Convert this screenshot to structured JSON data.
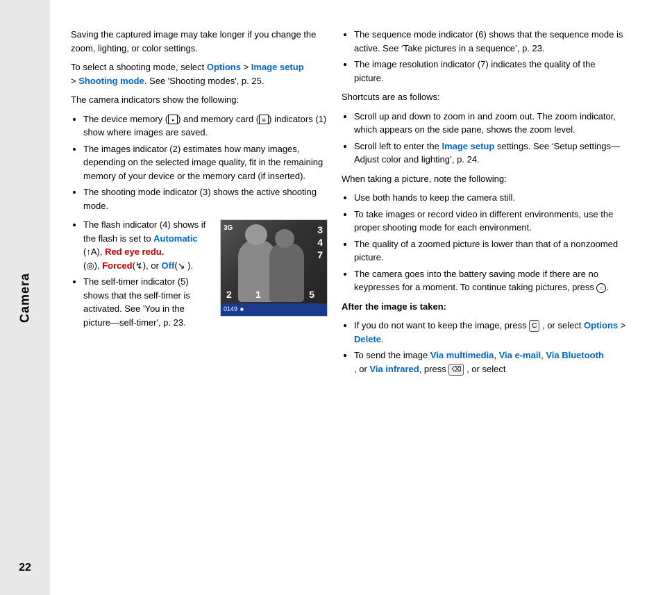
{
  "sidebar": {
    "title": "Camera",
    "page_number": "22"
  },
  "content": {
    "left_column": {
      "intro_text": "Saving the captured image may take longer if you change the zoom, lighting, or color settings.",
      "select_mode_text": "To select a shooting mode, select ",
      "options_link": "Options",
      "greater_than": " > ",
      "image_setup_link": "Image setup",
      "shooting_mode_link": "Shooting mode",
      "see_shooting_modes": ". See 'Shooting modes', p. 25.",
      "indicators_heading": "The camera indicators show the following:",
      "bullet_1": "The device memory (",
      "bullet_1_mid": ") and memory card (",
      "bullet_1_end": ") indicators (1) show where images are saved.",
      "bullet_2": "The images indicator (2) estimates how many images, depending on the selected image quality, fit in the remaining memory of your device or the memory card (if inserted).",
      "bullet_3": "The shooting mode indicator (3) shows the active shooting mode.",
      "bullet_4_start": "The flash indicator (4) shows if the flash is set to ",
      "automatic_link": "Automatic",
      "bullet_4_a_label": "(↑A",
      "bullet_4_a_end": "), ",
      "red_eye_link": "Red eye redu.",
      "bullet_4_b": "(◎), ",
      "forced_link": "Forced",
      "bullet_4_c": "(↯), or ",
      "off_link": "Off",
      "bullet_4_d": "(↘ ).",
      "bullet_5_start": "The self-timer indicator (5) shows that the self-timer is activated. See 'You in the picture—self-timer', p. 23.",
      "camera_numbers": {
        "n3": "3",
        "n4": "4",
        "n7": "7",
        "n2": "2",
        "n1": "1",
        "n5": "5"
      },
      "camera_bottom": {
        "counter": "0149",
        "icon": "■"
      }
    },
    "right_column": {
      "bullet_seq": "The sequence mode indicator (6) shows that the sequence mode is active. See ‘Take pictures in a sequence’, p. 23.",
      "bullet_res": "The image resolution indicator (7) indicates the quality of the picture.",
      "shortcuts_heading": "Shortcuts are as follows:",
      "scroll_zoom": "Scroll up and down to zoom in and zoom out. The zoom indicator, which appears on the side pane, shows the zoom level.",
      "scroll_image_setup": "Scroll left to enter the ",
      "image_setup_link": "Image setup",
      "scroll_image_setup_end": " settings. See ‘Setup settings—Adjust color and lighting’, p. 24.",
      "taking_heading": "When taking a picture, note the following:",
      "taking_1": "Use both hands to keep the camera still.",
      "taking_2": "To take images or record video in different environments, use the proper shooting mode for each environment.",
      "taking_3": "The quality of a zoomed picture is lower than that of a nonzoomed picture.",
      "taking_4": "The camera goes into the battery saving mode if there are no keypresses for a moment. To continue taking pictures, press ",
      "taking_4_end": ".",
      "after_heading": "After the image is taken:",
      "after_1_start": "If you do not want to keep the image, press ",
      "after_1_mid": " , or select ",
      "after_options_link": "Options",
      "after_delete_link": "Delete",
      "after_2_start": "To send the image ",
      "via_multimedia_link": "Via multimedia",
      "comma1": ", ",
      "via_email_link": "Via e-mail",
      "comma2": ", ",
      "via_bluetooth_link": "Via Bluetooth",
      "comma3": ", or ",
      "via_infrared_link": "Via infrared",
      "after_2_end": ", press ",
      "after_2_final": " , or select"
    }
  }
}
